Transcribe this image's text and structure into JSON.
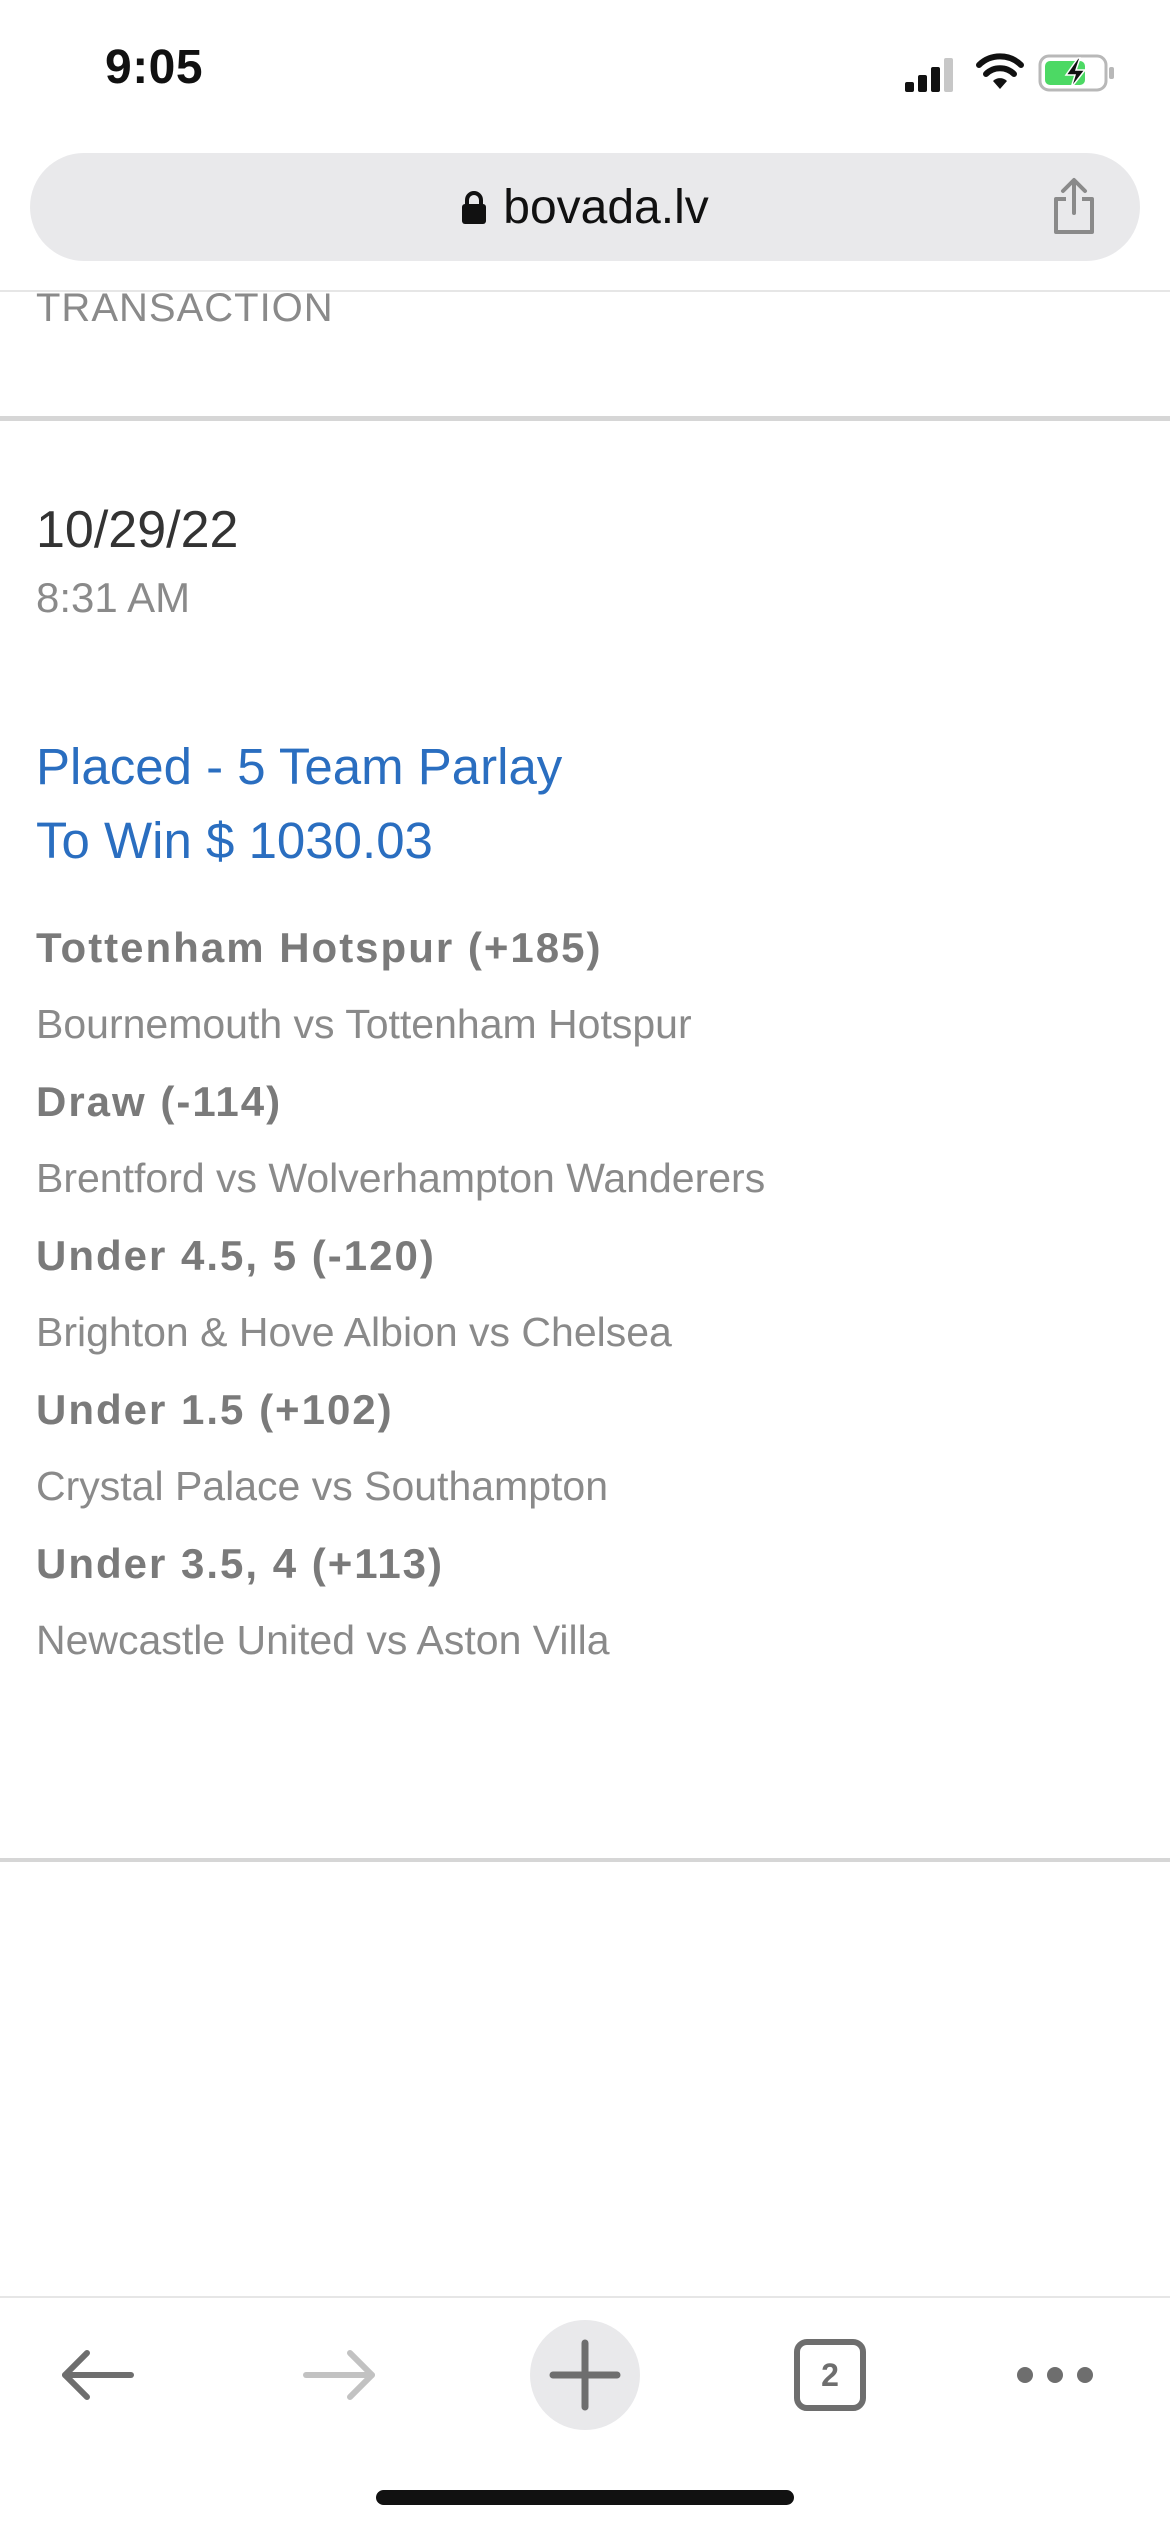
{
  "status_bar": {
    "time": "9:05"
  },
  "browser": {
    "url": "bovada.lv",
    "tabs_count": "2"
  },
  "transaction": {
    "section_label": "TRANSACTION",
    "date": "10/29/22",
    "time": "8:31 AM",
    "title_line1": "Placed - 5 Team Parlay",
    "title_line2": "To Win $ 1030.03",
    "legs": [
      {
        "pick": "Tottenham Hotspur (+185)",
        "match": "Bournemouth vs Tottenham Hotspur"
      },
      {
        "pick": "Draw (-114)",
        "match": "Brentford vs Wolverhampton Wanderers"
      },
      {
        "pick": "Under 4.5, 5 (-120)",
        "match": "Brighton & Hove Albion vs Chelsea"
      },
      {
        "pick": "Under 1.5 (+102)",
        "match": "Crystal Palace vs Southampton"
      },
      {
        "pick": "Under 3.5, 4 (+113)",
        "match": "Newcastle United vs Aston Villa"
      }
    ]
  },
  "icons": {
    "signal": "cellular-signal-icon",
    "wifi": "wifi-icon",
    "battery": "battery-charging-icon",
    "lock": "lock-icon",
    "share": "share-icon",
    "back": "back-arrow-icon",
    "forward": "forward-arrow-icon",
    "new_tab": "plus-icon",
    "tabs": "tabs-icon",
    "more": "more-icon"
  },
  "colors": {
    "accent_blue": "#2a6ec0",
    "battery_green": "#4cd964"
  }
}
